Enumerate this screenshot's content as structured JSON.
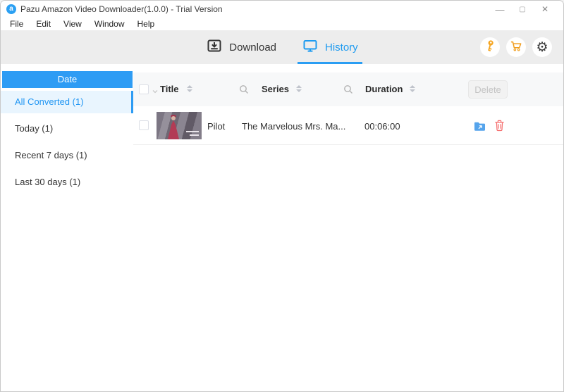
{
  "titlebar": {
    "title": "Pazu Amazon Video Downloader(1.0.0) - Trial Version",
    "app_icon_letter": "a",
    "minimize_glyph": "—",
    "maximize_glyph": "▢",
    "close_glyph": "✕"
  },
  "menubar": {
    "items": [
      "File",
      "Edit",
      "View",
      "Window",
      "Help"
    ]
  },
  "toolbar": {
    "tabs": [
      {
        "label": "Download",
        "active": false
      },
      {
        "label": "History",
        "active": true
      }
    ],
    "icons": {
      "key": "license-key",
      "cart": "shopping-cart",
      "gear": "settings",
      "gear_glyph": "⚙"
    }
  },
  "sidebar": {
    "header": "Date",
    "items": [
      {
        "label": "All Converted (1)",
        "selected": true
      },
      {
        "label": "Today (1)",
        "selected": false
      },
      {
        "label": "Recent 7 days (1)",
        "selected": false
      },
      {
        "label": "Last 30 days (1)",
        "selected": false
      }
    ]
  },
  "table": {
    "headers": {
      "title": "Title",
      "series": "Series",
      "duration": "Duration"
    },
    "delete_button": "Delete",
    "rows": [
      {
        "title": "Pilot",
        "series": "The Marvelous Mrs. Ma...",
        "duration": "00:06:00",
        "thumbnail": "the-marvelous-mrs-maisel-still",
        "actions": [
          "open-folder",
          "delete-item"
        ]
      }
    ]
  },
  "colors": {
    "accent_blue": "#1e9bf0",
    "sidebar_header_bg": "#2e9cf4",
    "sidebar_selected_bg": "#e9f5fe",
    "toolbar_bg": "#ededed",
    "orange": "#f5a623",
    "danger_red": "#f56c6c",
    "folder_blue": "#55a4ec"
  }
}
